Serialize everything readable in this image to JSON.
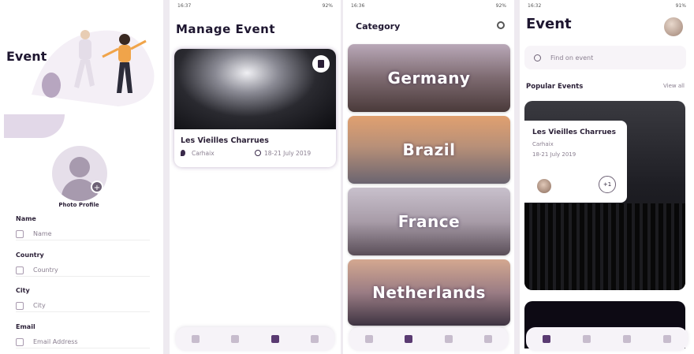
{
  "panel1": {
    "title": "Event",
    "photo_label": "Photo Profile",
    "fields": [
      {
        "label": "Name",
        "placeholder": "Name"
      },
      {
        "label": "Country",
        "placeholder": "Country"
      },
      {
        "label": "City",
        "placeholder": "City"
      },
      {
        "label": "Email",
        "placeholder": "Email Address"
      }
    ]
  },
  "panel2": {
    "status_time": "16:37",
    "status_battery": "92%",
    "title": "Manage Event",
    "event": {
      "name": "Les Vieilles Charrues",
      "location": "Carhaix",
      "dates": "18-21 July 2019"
    }
  },
  "panel3": {
    "status_time": "16:36",
    "status_battery": "92%",
    "title": "Category",
    "categories": [
      "Germany",
      "Brazil",
      "France",
      "Netherlands"
    ]
  },
  "panel4": {
    "status_time": "16:32",
    "status_battery": "91%",
    "title": "Event",
    "search_placeholder": "Find on event",
    "section_title": "Popular Events",
    "view_all": "View all",
    "featured": {
      "name": "Les Vieilles Charrues",
      "location": "Carhaix",
      "dates": "18-21 July 2019",
      "extra_count": "+1"
    }
  },
  "colors": {
    "accent": "#5a3a72",
    "text": "#1e1630",
    "muted": "#8a7f90"
  }
}
